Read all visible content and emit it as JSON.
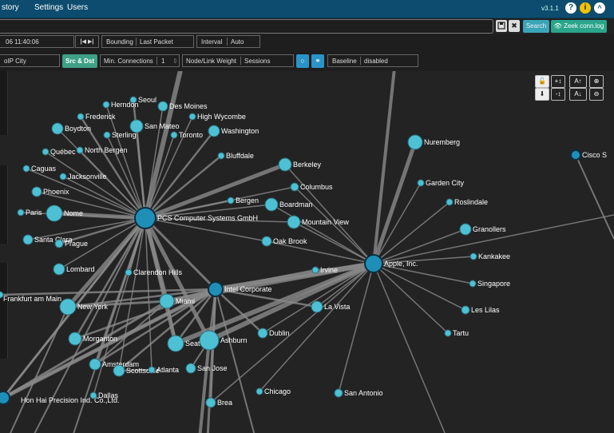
{
  "navbar": {
    "items": [
      "story",
      "Settings",
      "Users"
    ],
    "version": "v3.1.1",
    "help_icon": "question-circle-icon",
    "info_icon": "info-circle-icon",
    "collapse_icon": "chevron-up-circle-icon"
  },
  "searchbar": {
    "value": "",
    "save_icon": "floppy-disk-icon",
    "clear_icon": "x-icon",
    "search_label": "Search",
    "zeek_label": "Zeek conn.log",
    "zeek_icon": "eye-icon"
  },
  "timebar": {
    "time_value": "06 11:40:06",
    "bounding_label": "Bounding",
    "bounding_value": "Last Packet",
    "interval_label": "Interval",
    "interval_value": "Auto"
  },
  "controls": {
    "field_value": "oIP City",
    "src_dst_label": "Src & Dst",
    "min_conn_label": "Min. Connections",
    "min_conn_value": "1",
    "weight_label": "Node/Link Weight",
    "weight_value": "Sessions",
    "baseline_label": "Baseline",
    "baseline_value": "disabled"
  },
  "graph_controls": [
    "unlock-icon",
    "plus-node-dist-icon",
    "font-size-up-icon",
    "zoom-in-icon",
    "download-icon",
    "minus-node-dist-icon",
    "font-size-down-icon",
    "zoom-out-icon"
  ],
  "graph_control_labels": [
    "+↕",
    "A↑",
    "-↕",
    "A↓"
  ],
  "nodes": [
    {
      "label": "Seoul"
    },
    {
      "label": "Herndon"
    },
    {
      "label": "Des Moines"
    },
    {
      "label": "Frederick"
    },
    {
      "label": "High Wycombe"
    },
    {
      "label": "Boydton"
    },
    {
      "label": "San Mateo"
    },
    {
      "label": "Sterling"
    },
    {
      "label": "Toronto"
    },
    {
      "label": "Washington"
    },
    {
      "label": "Québec"
    },
    {
      "label": "North Bergen"
    },
    {
      "label": "Bluffdale"
    },
    {
      "label": "Caguas"
    },
    {
      "label": "Jacksonville"
    },
    {
      "label": "Berkeley"
    },
    {
      "label": "Columbus"
    },
    {
      "label": "Phoenix"
    },
    {
      "label": "Bergen"
    },
    {
      "label": "Boardman"
    },
    {
      "label": "Paris"
    },
    {
      "label": "Nome"
    },
    {
      "label": "PCS Computer Systems GmbH"
    },
    {
      "label": "Mountain View"
    },
    {
      "label": "Santa Clara"
    },
    {
      "label": "Prague"
    },
    {
      "label": "Oak Brook"
    },
    {
      "label": "Lombard"
    },
    {
      "label": "Clarendon Hills"
    },
    {
      "label": "Irvine"
    },
    {
      "label": "Intel Corporate"
    },
    {
      "label": "Frankfurt am Main"
    },
    {
      "label": "New York"
    },
    {
      "label": "Miami"
    },
    {
      "label": "La Vista"
    },
    {
      "label": "Dublin"
    },
    {
      "label": "Morganton"
    },
    {
      "label": "Seattle"
    },
    {
      "label": "Ashburn"
    },
    {
      "label": "Amsterdam"
    },
    {
      "label": "Scottsdale"
    },
    {
      "label": "Atlanta"
    },
    {
      "label": "San Jose"
    },
    {
      "label": "Hon Hai Precision Ind. Co.,Ltd."
    },
    {
      "label": "Dallas"
    },
    {
      "label": "Chicago"
    },
    {
      "label": "San Antonio"
    },
    {
      "label": "Brea"
    },
    {
      "label": "Nuremberg"
    },
    {
      "label": "Cisco S"
    },
    {
      "label": "Garden City"
    },
    {
      "label": "Roslindale"
    },
    {
      "label": "Granollers"
    },
    {
      "label": "Kankakee"
    },
    {
      "label": "Apple, Inc."
    },
    {
      "label": "Singapore"
    },
    {
      "label": "Les Lilas"
    },
    {
      "label": "Tartu"
    }
  ]
}
